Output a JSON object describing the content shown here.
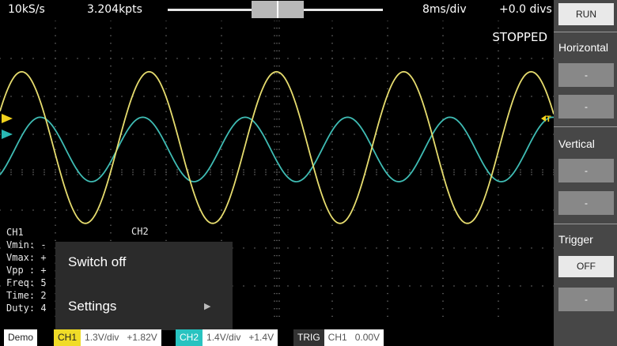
{
  "header": {
    "sample_rate": "10kS/s",
    "points": "3.204kpts",
    "timebase": "8ms/div",
    "offset": "+0.0 divs"
  },
  "status": "STOPPED",
  "side_panel": {
    "run_label": "RUN",
    "horizontal_label": "Horizontal",
    "vertical_label": "Vertical",
    "trigger_label": "Trigger",
    "off_label": "OFF",
    "minus_label": "-"
  },
  "measurements": {
    "ch1_title": "CH1",
    "ch2_title": "CH2",
    "lines": [
      "Vmin: -",
      "Vmax: +",
      "Vpp : +",
      "Freq: 5",
      "Time: 2",
      "Duty: 4"
    ]
  },
  "context_menu": {
    "items": [
      "Switch off",
      "Settings"
    ]
  },
  "bottom_bar": {
    "demo": "Demo",
    "ch1_tag": "CH1",
    "ch1_scale": "1.3V/div",
    "ch1_offset": "+1.82V",
    "ch2_tag": "CH2",
    "ch2_scale": "1.4V/div",
    "ch2_offset": "+1.4V",
    "trig_tag": "TRIG",
    "trig_source": "CH1",
    "trig_level": "0.00V"
  },
  "colors": {
    "ch1": "#e6dc6e",
    "ch2": "#3fbcb4",
    "ch1_marker": "#f2d21c",
    "ch2_marker": "#29b9b4",
    "ch1_badge": "#f0dc28",
    "ch2_badge": "#28c3c0"
  },
  "signals": {
    "ch1": {
      "type": "sine",
      "period_divs": 2.3,
      "amplitude_divs": 2.0,
      "offset_divs": 0.65
    },
    "ch2": {
      "type": "sine",
      "period_divs": 1.85,
      "amplitude_divs": 0.85,
      "offset_divs": 0.6
    }
  },
  "icons": {
    "submenu": "triangle-right-icon",
    "trigger_marker": "trigger-arrow-icon"
  }
}
